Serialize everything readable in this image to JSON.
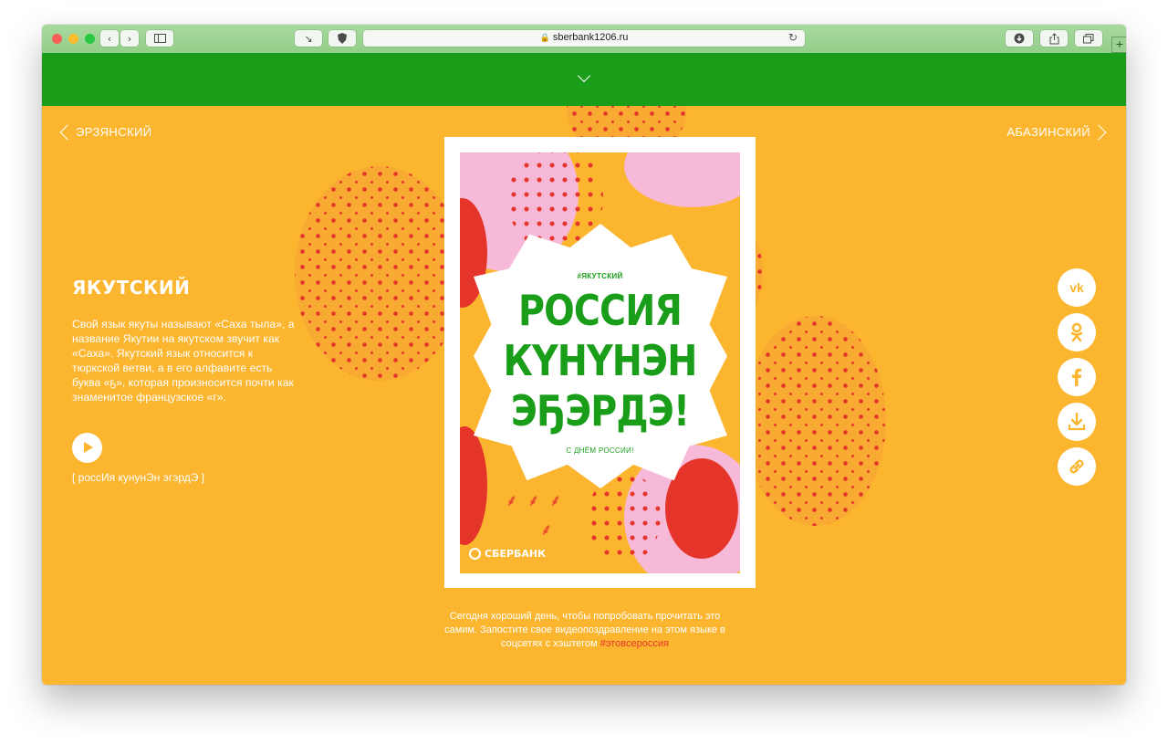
{
  "browser": {
    "url": "sberbank1206.ru",
    "lock_icon": "lock-icon",
    "reload_icon": "reload-icon"
  },
  "nav": {
    "prev_language": "ЭРЗЯНСКИЙ",
    "next_language": "АБАЗИНСКИЙ"
  },
  "language": {
    "title": "ЯКУТСКИЙ",
    "description": "Свой язык якуты называют «Саха тыла», а название Якутии на якутском звучит как «Саха». Якутский язык относится к тюркской ветви, а в его алфавите есть буква «ҕ», которая произносится почти как знаменитое французское «г».",
    "transcription": "[ россИя кунунЭн эгэрдЭ ]"
  },
  "poster": {
    "hashtag": "#ЯКУТСКИЙ",
    "line1": "РОССИЯ",
    "line2": "КҮНҮНЭН",
    "line3": "ЭҔЭРДЭ!",
    "subtitle": "С ДНЁМ РОССИИ!",
    "logo": "СБЕРБАНК"
  },
  "share": [
    "vk-icon",
    "odnoklassniki-icon",
    "facebook-icon",
    "download-icon",
    "link-icon"
  ],
  "footer": {
    "text": "Сегодня хороший день, чтобы попробовать прочитать это самим. Запостите свое видеопоздравление на этом языке в соцсетях с хэштегом ",
    "hashtag": "#этовсероссия"
  },
  "colors": {
    "green": "#1a9e1a",
    "orange": "#fbb52f",
    "red": "#e5352b",
    "pink": "#f7b9d8"
  }
}
